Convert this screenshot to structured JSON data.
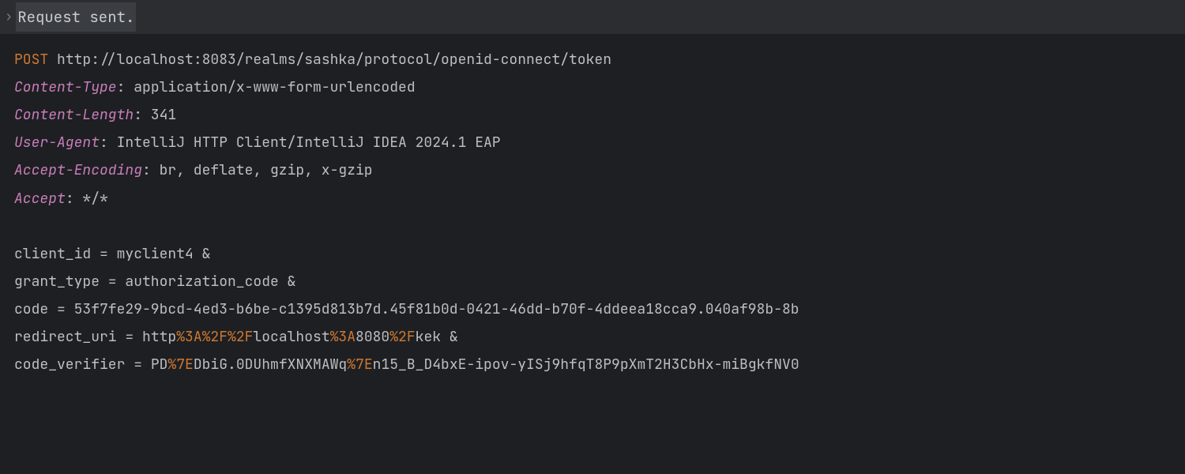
{
  "status": "Request sent.",
  "request": {
    "method": "POST",
    "url": "http://localhost:8083/realms/sashka/protocol/openid-connect/token",
    "headers": [
      {
        "name": "Content-Type",
        "value": "application/x-www-form-urlencoded"
      },
      {
        "name": "Content-Length",
        "value": "341"
      },
      {
        "name": "User-Agent",
        "value": "IntelliJ HTTP Client/IntelliJ IDEA 2024.1 EAP"
      },
      {
        "name": "Accept-Encoding",
        "value": "br, deflate, gzip, x-gzip"
      },
      {
        "name": "Accept",
        "value": "*/*"
      }
    ]
  },
  "body": {
    "params": [
      {
        "name": "client_id",
        "value_parts": [
          {
            "t": "plain",
            "v": "myclient4"
          }
        ],
        "amp": true
      },
      {
        "name": "grant_type",
        "value_parts": [
          {
            "t": "plain",
            "v": "authorization_code"
          }
        ],
        "amp": true
      },
      {
        "name": "code",
        "value_parts": [
          {
            "t": "plain",
            "v": "53f7fe29-9bcd-4ed3-b6be-c1395d813b7d.45f81b0d-0421-46dd-b70f-4ddeea18cca9.040af98b-8b"
          }
        ],
        "amp": false
      },
      {
        "name": "redirect_uri",
        "value_parts": [
          {
            "t": "plain",
            "v": "http"
          },
          {
            "t": "enc",
            "v": "%3A%2F%2F"
          },
          {
            "t": "plain",
            "v": "localhost"
          },
          {
            "t": "enc",
            "v": "%3A"
          },
          {
            "t": "plain",
            "v": "8080"
          },
          {
            "t": "enc",
            "v": "%2F"
          },
          {
            "t": "plain",
            "v": "kek"
          }
        ],
        "amp": true
      },
      {
        "name": "code_verifier",
        "value_parts": [
          {
            "t": "plain",
            "v": "PD"
          },
          {
            "t": "enc",
            "v": "%7E"
          },
          {
            "t": "plain",
            "v": "DbiG.0DUhmfXNXMAWq"
          },
          {
            "t": "enc",
            "v": "%7E"
          },
          {
            "t": "plain",
            "v": "n15_B_D4bxE-ipov-yISj9hfqT8P9pXmT2H3CbHx-miBgkfNV0"
          }
        ],
        "amp": false
      }
    ]
  }
}
